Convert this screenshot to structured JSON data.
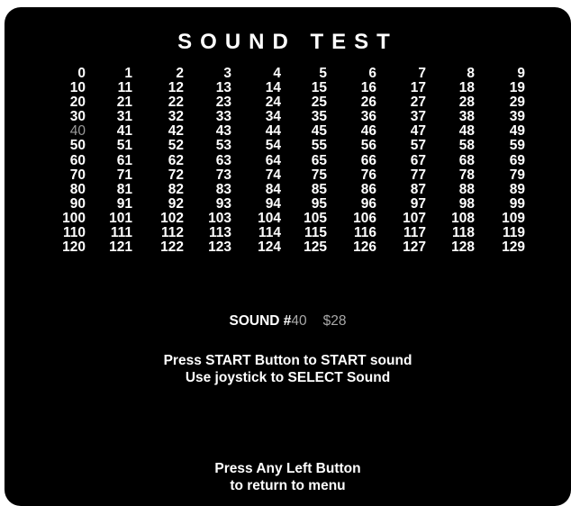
{
  "title": "SOUND TEST",
  "grid": {
    "rows": [
      [
        "0",
        "1",
        "2",
        "3",
        "4",
        "5",
        "6",
        "7",
        "8",
        "9"
      ],
      [
        "10",
        "11",
        "12",
        "13",
        "14",
        "15",
        "16",
        "17",
        "18",
        "19"
      ],
      [
        "20",
        "21",
        "22",
        "23",
        "24",
        "25",
        "26",
        "27",
        "28",
        "29"
      ],
      [
        "30",
        "31",
        "32",
        "33",
        "34",
        "35",
        "36",
        "37",
        "38",
        "39"
      ],
      [
        "40",
        "41",
        "42",
        "43",
        "44",
        "45",
        "46",
        "47",
        "48",
        "49"
      ],
      [
        "50",
        "51",
        "52",
        "53",
        "54",
        "55",
        "56",
        "57",
        "58",
        "59"
      ],
      [
        "60",
        "61",
        "62",
        "63",
        "64",
        "65",
        "66",
        "67",
        "68",
        "69"
      ],
      [
        "70",
        "71",
        "72",
        "73",
        "74",
        "75",
        "76",
        "77",
        "78",
        "79"
      ],
      [
        "80",
        "81",
        "82",
        "83",
        "84",
        "85",
        "86",
        "87",
        "88",
        "89"
      ],
      [
        "90",
        "91",
        "92",
        "93",
        "94",
        "95",
        "96",
        "97",
        "98",
        "99"
      ],
      [
        "100",
        "101",
        "102",
        "103",
        "104",
        "105",
        "106",
        "107",
        "108",
        "109"
      ],
      [
        "110",
        "111",
        "112",
        "113",
        "114",
        "115",
        "116",
        "117",
        "118",
        "119"
      ],
      [
        "120",
        "121",
        "122",
        "123",
        "124",
        "125",
        "126",
        "127",
        "128",
        "129"
      ]
    ],
    "selected": "40",
    "selected_color": "#9a9a9a"
  },
  "sound": {
    "label": "SOUND #",
    "number": "40",
    "hex": "$28"
  },
  "instructions": {
    "line1": "Press START Button to START sound",
    "line2": "Use joystick to SELECT Sound"
  },
  "footer": {
    "line1": "Press Any Left Button",
    "line2": "to return to menu"
  }
}
